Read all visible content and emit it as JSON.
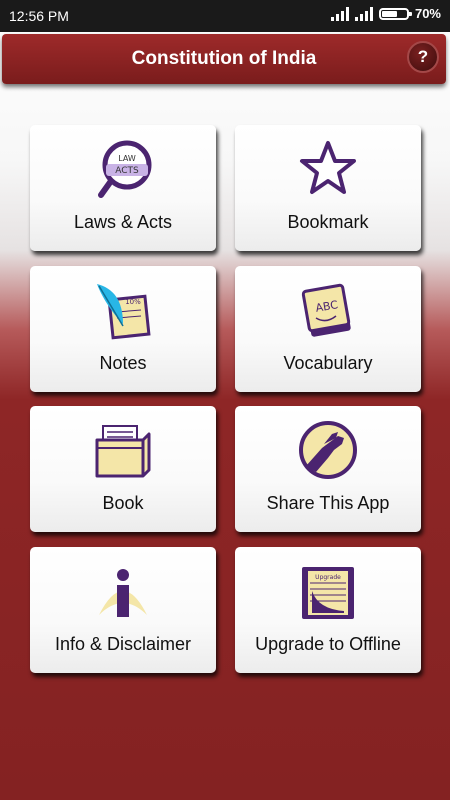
{
  "status": {
    "time": "12:56 PM",
    "battery": "70%",
    "battery_level": 0.7
  },
  "header": {
    "title": "Constitution of India",
    "help_label": "?"
  },
  "tiles": [
    {
      "label": "Laws & Acts",
      "icon": "magnifier-law-acts-icon",
      "icon_text": [
        "LAW",
        "ACTS"
      ]
    },
    {
      "label": "Bookmark",
      "icon": "star-icon"
    },
    {
      "label": "Notes",
      "icon": "quill-notes-icon",
      "icon_text": [
        "10%"
      ]
    },
    {
      "label": "Vocabulary",
      "icon": "abc-notepad-icon",
      "icon_text": [
        "ABC"
      ]
    },
    {
      "label": "Book",
      "icon": "book-box-icon"
    },
    {
      "label": "Share This App",
      "icon": "handshake-icon"
    },
    {
      "label": "Info & Disclaimer",
      "icon": "info-icon"
    },
    {
      "label": "Upgrade to Offline",
      "icon": "clipboard-chart-icon",
      "icon_text": [
        "Upgrade"
      ]
    }
  ],
  "colors": {
    "accent": "#8e2626",
    "icon_purple": "#4b2470",
    "icon_yellow": "#f4e6a8"
  }
}
